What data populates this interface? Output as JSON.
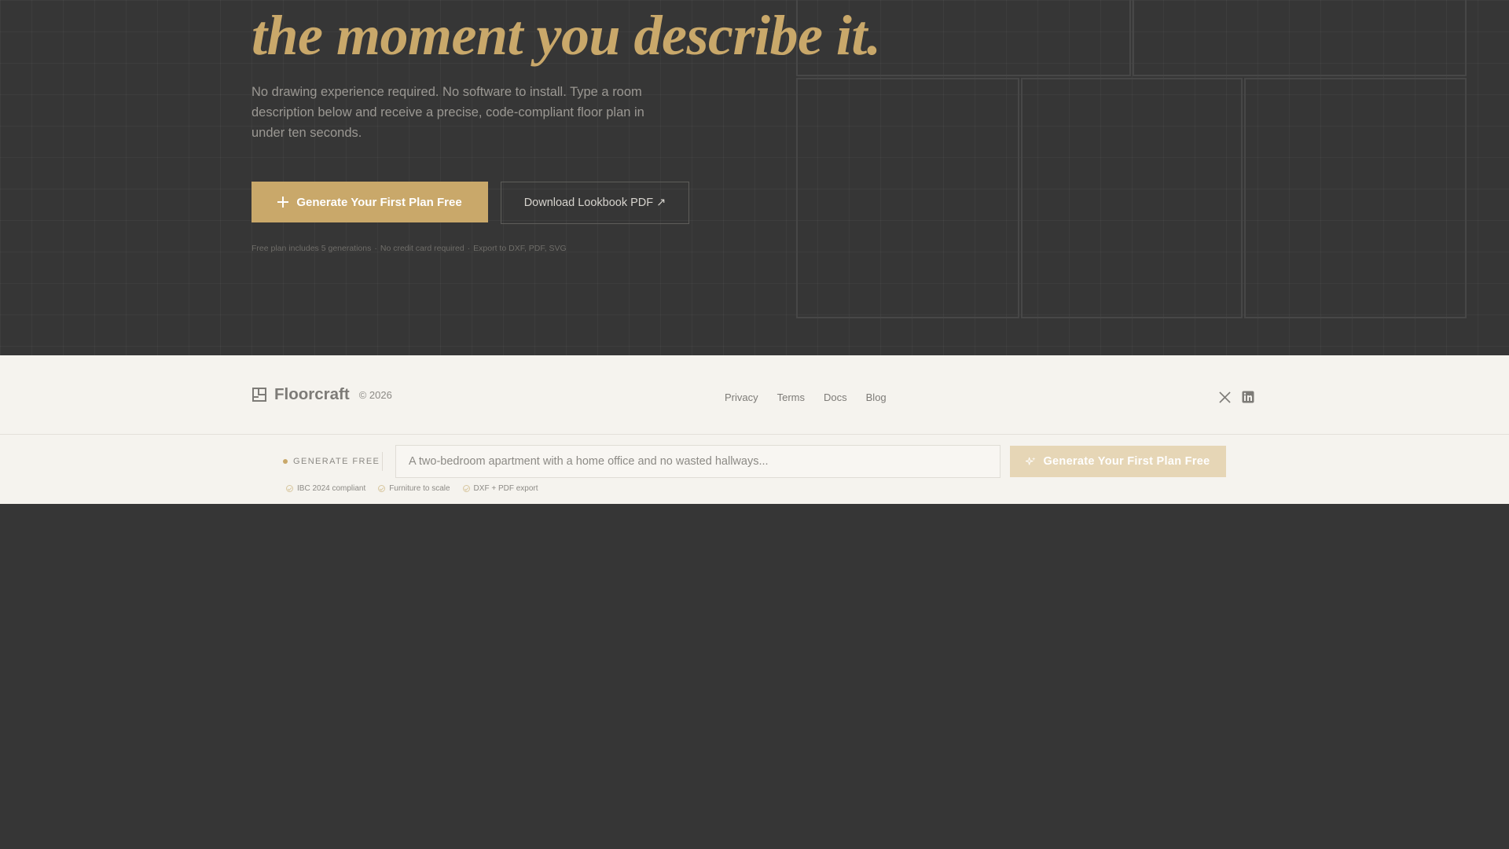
{
  "hero": {
    "headline": "the moment you describe it.",
    "lede": "No drawing experience required. No software to install. Type a room description below and receive a precise, code-compliant floor plan in under ten seconds.",
    "primary_cta": "Generate Your First Plan Free",
    "secondary_cta": "Download Lookbook PDF ↗",
    "fine_print": [
      "Free plan includes 5 generations",
      "No credit card required",
      "Export to DXF, PDF, SVG"
    ],
    "fine_print_separator": "·"
  },
  "footer": {
    "brand": "Floorcraft",
    "copyright": "© 2026",
    "links": [
      "Privacy",
      "Terms",
      "Docs",
      "Blog"
    ],
    "social_icons": [
      "x-icon",
      "linkedin-icon"
    ]
  },
  "generate_bar": {
    "label": "GENERATE FREE",
    "input_placeholder": "A two-bedroom apartment with a home office and no wasted hallways...",
    "button_label": "Generate Your First Plan Free",
    "features": [
      "IBC 2024 compliant",
      "Furniture to scale",
      "DXF + PDF export"
    ]
  },
  "colors": {
    "accent": "#c9a86a",
    "dark_bg": "#363636",
    "light_bg": "#f5f3ee"
  }
}
